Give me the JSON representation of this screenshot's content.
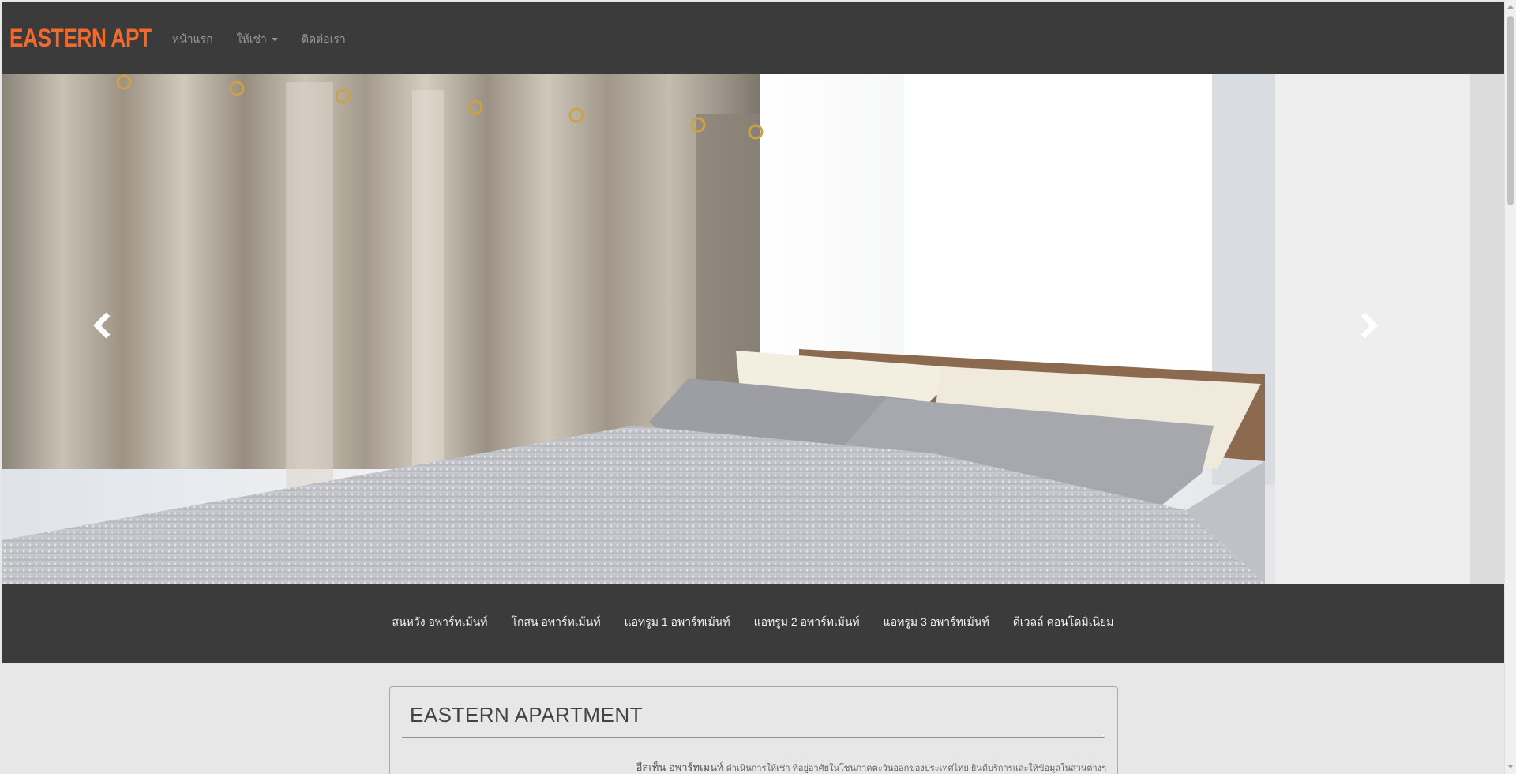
{
  "navbar": {
    "brand": "EASTERN APT",
    "links": [
      {
        "label": "หน้าแรก"
      },
      {
        "label": "ให้เช่า",
        "has_caret": true
      },
      {
        "label": "ติดต่อเรา"
      }
    ]
  },
  "carousel": {
    "prev_icon": "chevron-left-icon",
    "next_icon": "chevron-right-icon"
  },
  "subnav": {
    "links": [
      "สนหวัง อพาร์ทเม้นท์",
      "โกสน อพาร์ทเม้นท์",
      "แอทรูม 1 อพาร์ทเม้นท์",
      "แอทรูม 2 อพาร์ทเม้นท์",
      "แอทรูม 3 อพาร์ทเม้นท์",
      "ดีเวลล์ คอนโดมิเนี่ยม"
    ]
  },
  "panel": {
    "title": "EASTERN APARTMENT",
    "lead": "อีสเท็น อพาร์ทเมนท์",
    "text": "ดำเนินการให้เช่า ที่อยู่อาศัยในโซนภาคตะวันออกของประเทศไทย ยินดีบริการและให้ข้อมูลในส่วนต่างๆ"
  },
  "colors": {
    "navbar_bg": "#3b3b3b",
    "brand": "#ef6a2c",
    "page_bg": "#e7e7e7"
  }
}
